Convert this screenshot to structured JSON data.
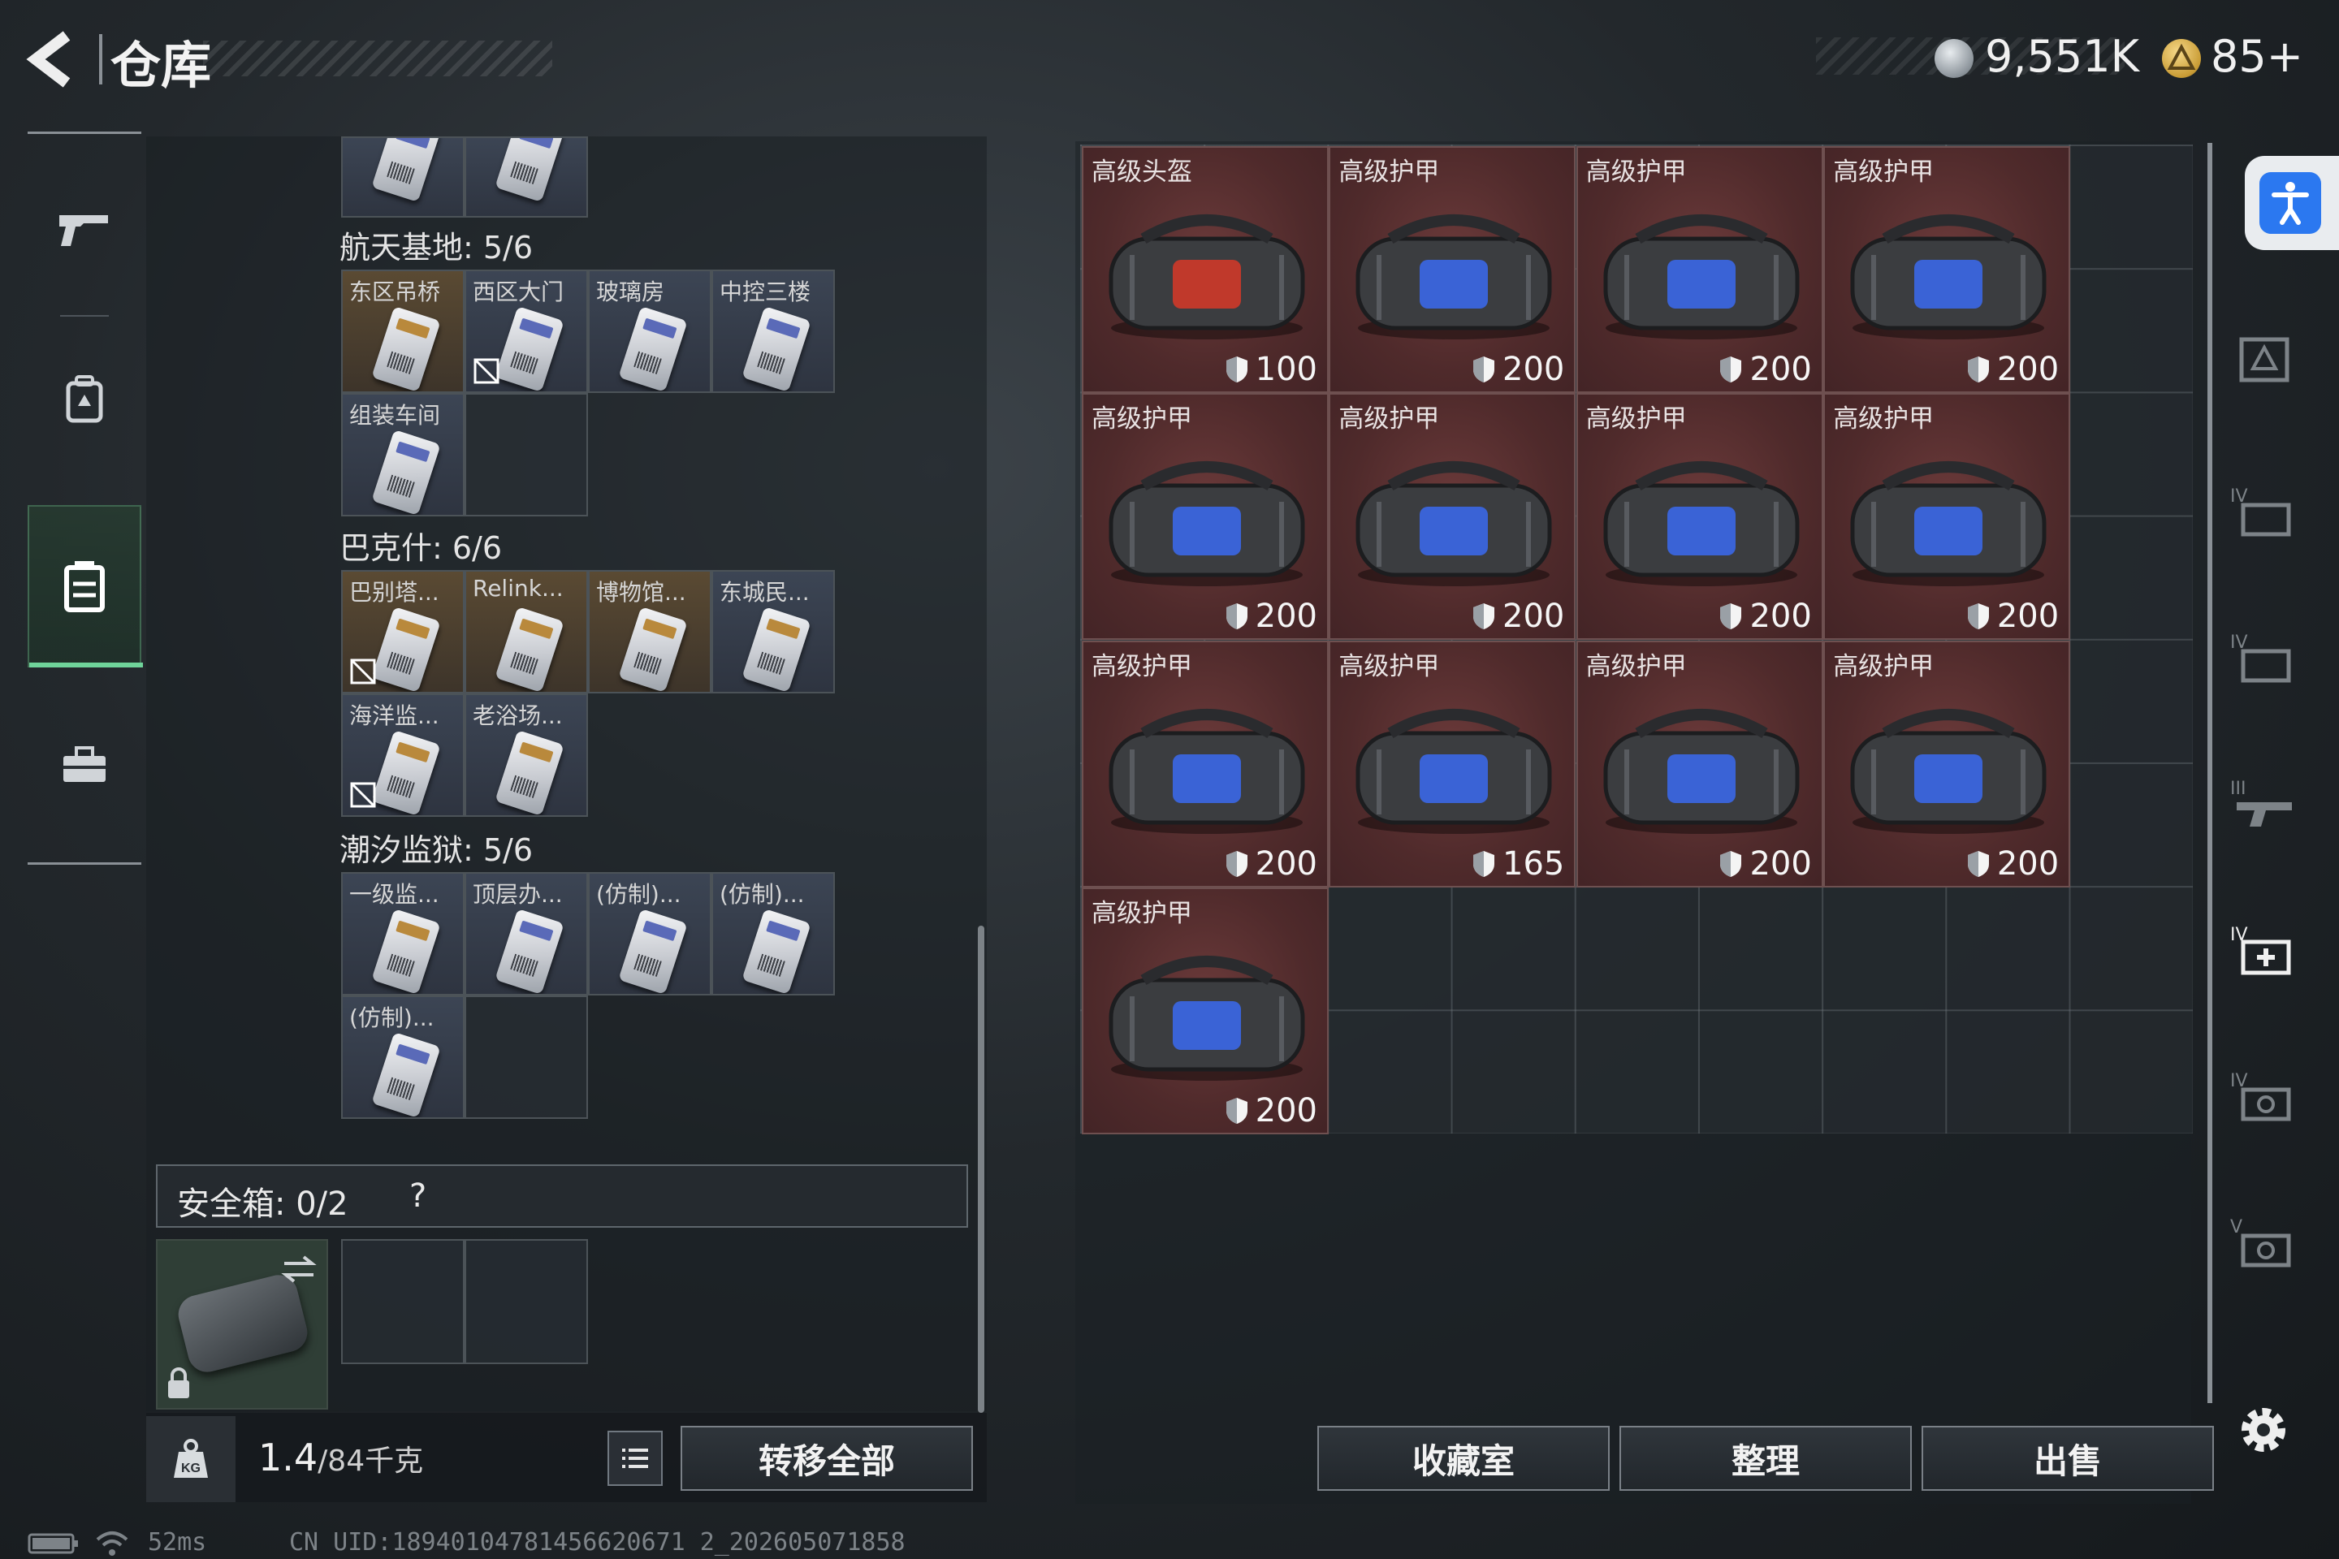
{
  "header": {
    "title": "仓库",
    "currency": [
      {
        "icon": "silver-coin-icon",
        "value": "9,551K"
      },
      {
        "icon": "gold-triangle-coin-icon",
        "value": "85+"
      }
    ]
  },
  "nav": {
    "items": [
      {
        "icon": "gun-icon",
        "active": false
      },
      {
        "icon": "backpack-icon",
        "active": false
      },
      {
        "icon": "storage-box-icon",
        "active": true
      },
      {
        "icon": "toolbox-icon",
        "active": false
      }
    ]
  },
  "left": {
    "groups": [
      {
        "title": "航天基地: 5/6"
      },
      {
        "title": "巴克什: 6/6"
      },
      {
        "title": "潮汐监狱: 5/6"
      }
    ],
    "g1": [
      "东区吊桥",
      "西区大门",
      "玻璃房",
      "中控三楼",
      "组装车间"
    ],
    "g2": [
      "巴别塔...",
      "Relink...",
      "博物馆...",
      "东城民...",
      "海洋监...",
      "老浴场..."
    ],
    "g3": [
      "一级监...",
      "顶层办...",
      "(仿制)...",
      "(仿制)...",
      "(仿制)..."
    ],
    "safe_box": {
      "label": "安全箱: 0/2",
      "help": "?"
    },
    "weight": {
      "value": "1.4",
      "total": "/84千克"
    },
    "transfer_all": "转移全部"
  },
  "right": {
    "items": [
      {
        "name": "高级头盔",
        "durability": "100",
        "accent": "#c0392b"
      },
      {
        "name": "高级护甲",
        "durability": "200",
        "accent": "#3a63d6"
      },
      {
        "name": "高级护甲",
        "durability": "200",
        "accent": "#3a63d6"
      },
      {
        "name": "高级护甲",
        "durability": "200",
        "accent": "#3a63d6"
      },
      {
        "name": "高级护甲",
        "durability": "200",
        "accent": "#3a63d6"
      },
      {
        "name": "高级护甲",
        "durability": "200",
        "accent": "#3a63d6"
      },
      {
        "name": "高级护甲",
        "durability": "200",
        "accent": "#3a63d6"
      },
      {
        "name": "高级护甲",
        "durability": "200",
        "accent": "#3a63d6"
      },
      {
        "name": "高级护甲",
        "durability": "200",
        "accent": "#3a63d6"
      },
      {
        "name": "高级护甲",
        "durability": "165",
        "accent": "#3a63d6"
      },
      {
        "name": "高级护甲",
        "durability": "200",
        "accent": "#3a63d6"
      },
      {
        "name": "高级护甲",
        "durability": "200",
        "accent": "#3a63d6"
      },
      {
        "name": "高级护甲",
        "durability": "200",
        "accent": "#3a63d6"
      }
    ],
    "buttons": {
      "collection": "收藏室",
      "sort": "整理",
      "sell": "出售"
    }
  },
  "status": {
    "ping": "52ms",
    "uid": "CN UID:18940104781456620671 2_202605071858"
  },
  "colors": {
    "accent_green": "#6fd49a",
    "item_bg": "#4f2a2b",
    "helmet_accent": "#c0392b",
    "armor_accent": "#3a63d6"
  }
}
